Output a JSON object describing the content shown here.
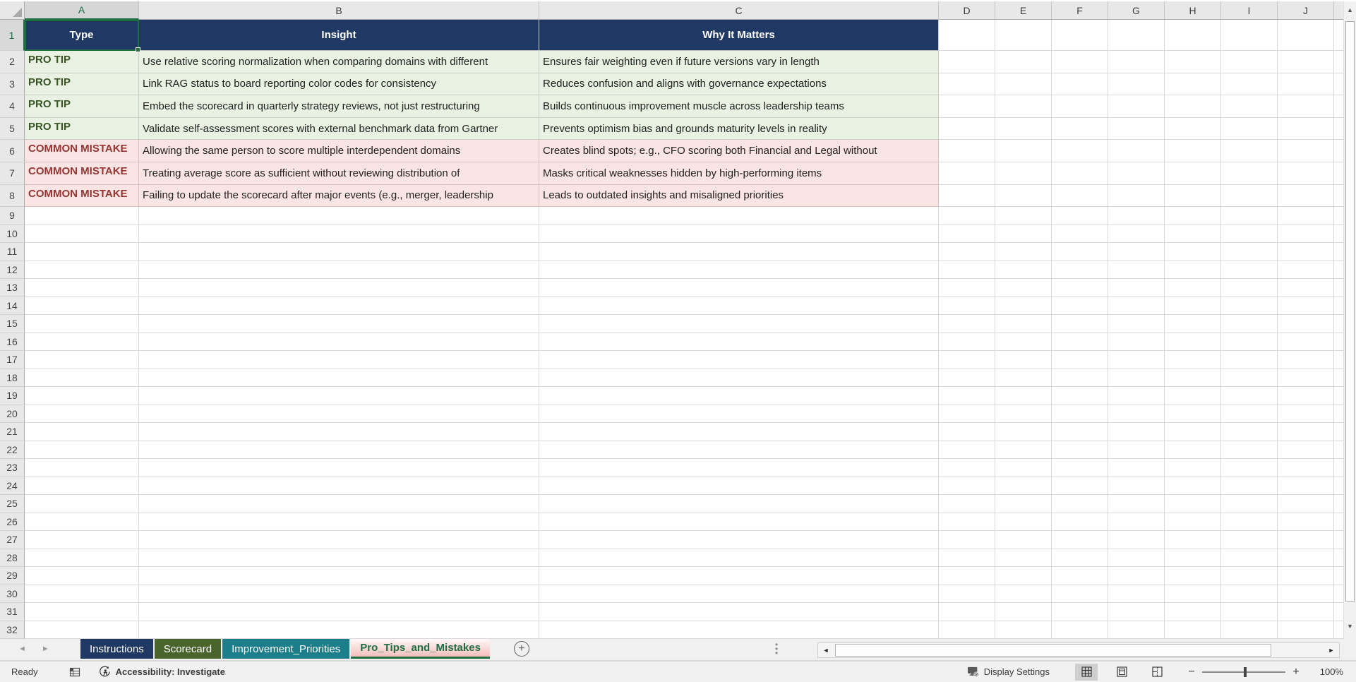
{
  "sheet": {
    "columns": [
      "A",
      "B",
      "C",
      "D",
      "E",
      "F",
      "G",
      "H",
      "I",
      "J"
    ],
    "visible_rows": {
      "first": 1,
      "last": 32
    },
    "selection": {
      "cell": "A1"
    },
    "table": {
      "headers": [
        "Type",
        "Insight",
        "Why It Matters"
      ],
      "rows": [
        {
          "type": "PRO TIP",
          "category": "tip",
          "insight": "Use relative scoring normalization when comparing domains with different",
          "why_it_matters": "Ensures fair weighting even if future versions vary in length"
        },
        {
          "type": "PRO TIP",
          "category": "tip",
          "insight": "Link RAG status to board reporting color codes for consistency",
          "why_it_matters": "Reduces confusion and aligns with governance expectations"
        },
        {
          "type": "PRO TIP",
          "category": "tip",
          "insight": "Embed the scorecard in quarterly strategy reviews, not just restructuring",
          "why_it_matters": "Builds continuous improvement muscle across leadership teams"
        },
        {
          "type": "PRO TIP",
          "category": "tip",
          "insight": "Validate self-assessment scores with external benchmark data from Gartner",
          "why_it_matters": "Prevents optimism bias and grounds maturity levels in reality"
        },
        {
          "type": "COMMON MISTAKE",
          "category": "mistake",
          "insight": "Allowing the same person to score multiple interdependent domains",
          "why_it_matters": "Creates blind spots; e.g., CFO scoring both Financial and Legal without"
        },
        {
          "type": "COMMON MISTAKE",
          "category": "mistake",
          "insight": "Treating average score as sufficient without reviewing distribution of",
          "why_it_matters": "Masks critical weaknesses hidden by high-performing items"
        },
        {
          "type": "COMMON MISTAKE",
          "category": "mistake",
          "insight": "Failing to update the scorecard after major events (e.g., merger, leadership",
          "why_it_matters": "Leads to outdated insights and misaligned priorities"
        }
      ]
    }
  },
  "sheet_tabs": {
    "items": [
      {
        "label": "Instructions",
        "color": "#203864",
        "active": false
      },
      {
        "label": "Scorecard",
        "color": "#4A652C",
        "active": false
      },
      {
        "label": "Improvement_Priorities",
        "color": "#1B7E8A",
        "active": false
      },
      {
        "label": "Pro_Tips_and_Mistakes",
        "color": "#F3BCB9",
        "active": true
      }
    ]
  },
  "status_bar": {
    "mode": "Ready",
    "accessibility": "Accessibility: Investigate",
    "display_settings": "Display Settings",
    "zoom": "100%"
  },
  "colors": {
    "header_fill": "#1F3864",
    "tip_fill": "#E8F1E2",
    "tip_text": "#375623",
    "mistake_fill": "#FBE5E4",
    "mistake_text": "#943634",
    "selection": "#1E6E41"
  }
}
